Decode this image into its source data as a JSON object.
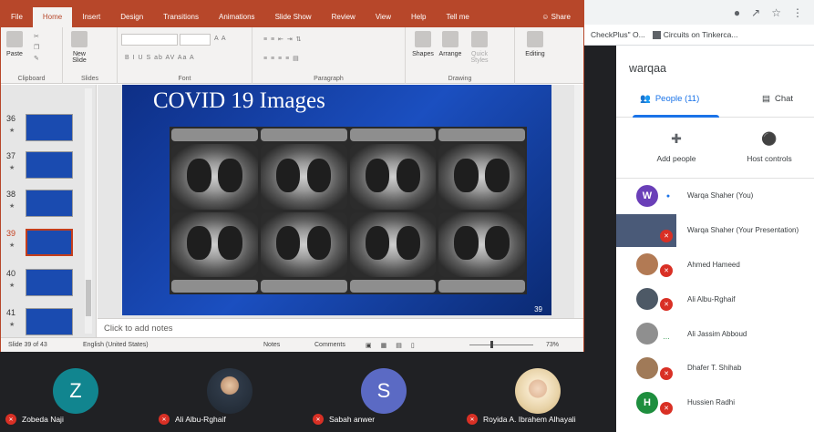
{
  "chrome": {
    "bookmarks": [
      "CheckPlus\" O...",
      "Circuits on Tinkerca..."
    ]
  },
  "meet": {
    "title": "warqaa",
    "tabs": {
      "people": "People (11)",
      "chat": "Chat"
    },
    "actions": {
      "add": "Add people",
      "host": "Host controls"
    },
    "participants": [
      {
        "name": "Warqa Shaher (You)",
        "initial": "W",
        "color": "#6a3fb8",
        "kind": "you"
      },
      {
        "name": "Warqa Shaher (Your Presentation)",
        "initial": "",
        "color": "#4a5a78",
        "kind": "presentation"
      },
      {
        "name": "Ahmed Hameed",
        "initial": "",
        "color": "#b27a54",
        "kind": "photo"
      },
      {
        "name": "Ali Albu-Rghaif",
        "initial": "",
        "color": "#4d5966",
        "kind": "photo"
      },
      {
        "name": "Ali Jassim Abboud",
        "initial": "",
        "color": "#8f8f8f",
        "kind": "photo"
      },
      {
        "name": "Dhafer T. Shihab",
        "initial": "",
        "color": "#a07a58",
        "kind": "photo"
      },
      {
        "name": "Hussien Radhi",
        "initial": "H",
        "color": "#1e8e3e",
        "kind": "you"
      }
    ]
  },
  "ppt": {
    "tabs": [
      "File",
      "Home",
      "Insert",
      "Design",
      "Transitions",
      "Animations",
      "Slide Show",
      "Review",
      "View",
      "Help",
      "Tell me"
    ],
    "active_tab": "Home",
    "share": "Share",
    "groups": {
      "clipboard": "Clipboard",
      "slides": "Slides",
      "font": "Font",
      "paragraph": "Paragraph",
      "drawing": "Drawing"
    },
    "buttons": {
      "paste": "Paste",
      "new_slide": "New Slide",
      "shapes": "Shapes",
      "arrange": "Arrange",
      "quick_styles": "Quick Styles",
      "editing": "Editing"
    },
    "thumbnails": [
      {
        "num": "",
        "sel": false
      },
      {
        "num": "36",
        "sel": false
      },
      {
        "num": "37",
        "sel": false
      },
      {
        "num": "38",
        "sel": false
      },
      {
        "num": "39",
        "sel": true
      },
      {
        "num": "40",
        "sel": false
      },
      {
        "num": "41",
        "sel": false
      }
    ],
    "slide": {
      "title": "COVID 19 Images",
      "number": "39"
    },
    "notes_placeholder": "Click to add notes",
    "status": {
      "slide_of": "Slide 39 of 43",
      "language": "English (United States)",
      "notes": "Notes",
      "comments": "Comments",
      "zoom": "73%"
    }
  },
  "tiles": [
    {
      "name": "Zobeda Naji",
      "initial": "Z",
      "color": "#11858f",
      "kind": "letter"
    },
    {
      "name": "Ali Albu-Rghaif",
      "initial": "",
      "color": "#333",
      "kind": "photo"
    },
    {
      "name": "Sabah anwer",
      "initial": "S",
      "color": "#5b6ac4",
      "kind": "letter"
    },
    {
      "name": "Royida A. Ibrahem Alhayali",
      "initial": "",
      "color": "#e8d3a8",
      "kind": "photo2"
    }
  ]
}
